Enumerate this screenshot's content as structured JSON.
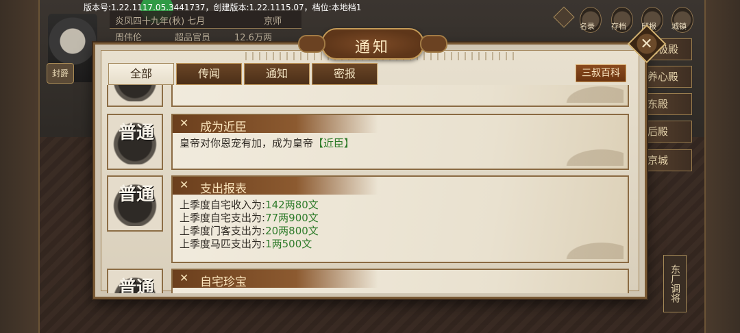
{
  "version_bar": {
    "text": "版本号:1.22.1117.05.3441737，创建版本:1.22.1115.07，档位:本地档1"
  },
  "bg_info": {
    "date": "炎凤四十九年(秋) 七月",
    "location": "京师",
    "player_name": "周伟伦",
    "rank": "超品官员",
    "wealth": "12.6万两",
    "rank_badge": "封爵"
  },
  "top_icons": [
    "名录",
    "存档",
    "邸报",
    "城镇"
  ],
  "side_buttons": [
    "太极殿",
    "养心殿",
    "东殿",
    "后殿",
    "京城"
  ],
  "vertical_button": "东厂调将",
  "dialog": {
    "title": "通知",
    "close_label": "✕",
    "tabs": [
      "全部",
      "传闻",
      "通知",
      "密报"
    ],
    "active_tab": "全部",
    "encyclopedia_label": "三叔百科"
  },
  "notices": [
    {
      "badge": "普通",
      "title": "",
      "lines": []
    },
    {
      "badge": "普通",
      "title": "成为近臣",
      "line_plain": "皇帝对你恩宠有加，成为皇帝",
      "line_green": "【近臣】"
    },
    {
      "badge": "普通",
      "title": "支出报表",
      "lines": [
        {
          "label": "上季度自宅收入为:",
          "value": "142两80文"
        },
        {
          "label": "上季度自宅支出为:",
          "value": "77两900文"
        },
        {
          "label": "上季度门客支出为:",
          "value": "20两800文"
        },
        {
          "label": "上季度马匹支出为:",
          "value": "1两500文"
        }
      ]
    },
    {
      "badge": "普通",
      "title": "自宅珍宝",
      "lines": []
    }
  ]
}
